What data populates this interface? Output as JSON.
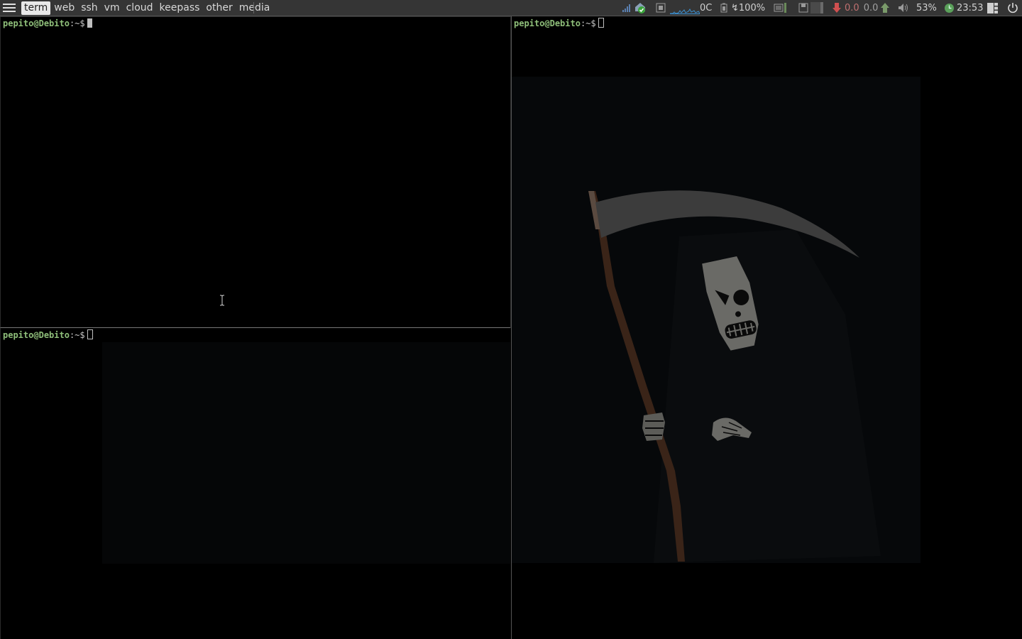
{
  "topbar": {
    "tags": [
      "term",
      "web",
      "ssh",
      "vm",
      "cloud",
      "keepass",
      "other",
      "media"
    ],
    "active_tag": "term",
    "temperature": "0C",
    "battery": "100%",
    "net_down": "0.0",
    "net_up": "0.0",
    "volume": "53%",
    "clock": "23:53"
  },
  "terminals": [
    {
      "user": "pepito",
      "at": "@",
      "host": "Debito",
      "path": ":~$"
    },
    {
      "user": "pepito",
      "at": "@",
      "host": "Debito",
      "path": ":~$"
    },
    {
      "user": "pepito",
      "at": "@",
      "host": "Debito",
      "path": ":~$"
    }
  ],
  "colors": {
    "bar_bg": "#353535",
    "prompt_user": "#8fbf7a",
    "cpu_graph": "#3a8fd0",
    "arrow_down": "#d05050",
    "arrow_up": "#7a9a6a"
  },
  "icons": [
    "menu-icon",
    "signal-icon",
    "vpn-shield-icon",
    "screen-icon",
    "battery-icon",
    "memory-icon",
    "disk-icon",
    "arrow-down-icon",
    "arrow-up-icon",
    "speaker-icon",
    "clock-icon",
    "layout-icon",
    "power-icon"
  ]
}
